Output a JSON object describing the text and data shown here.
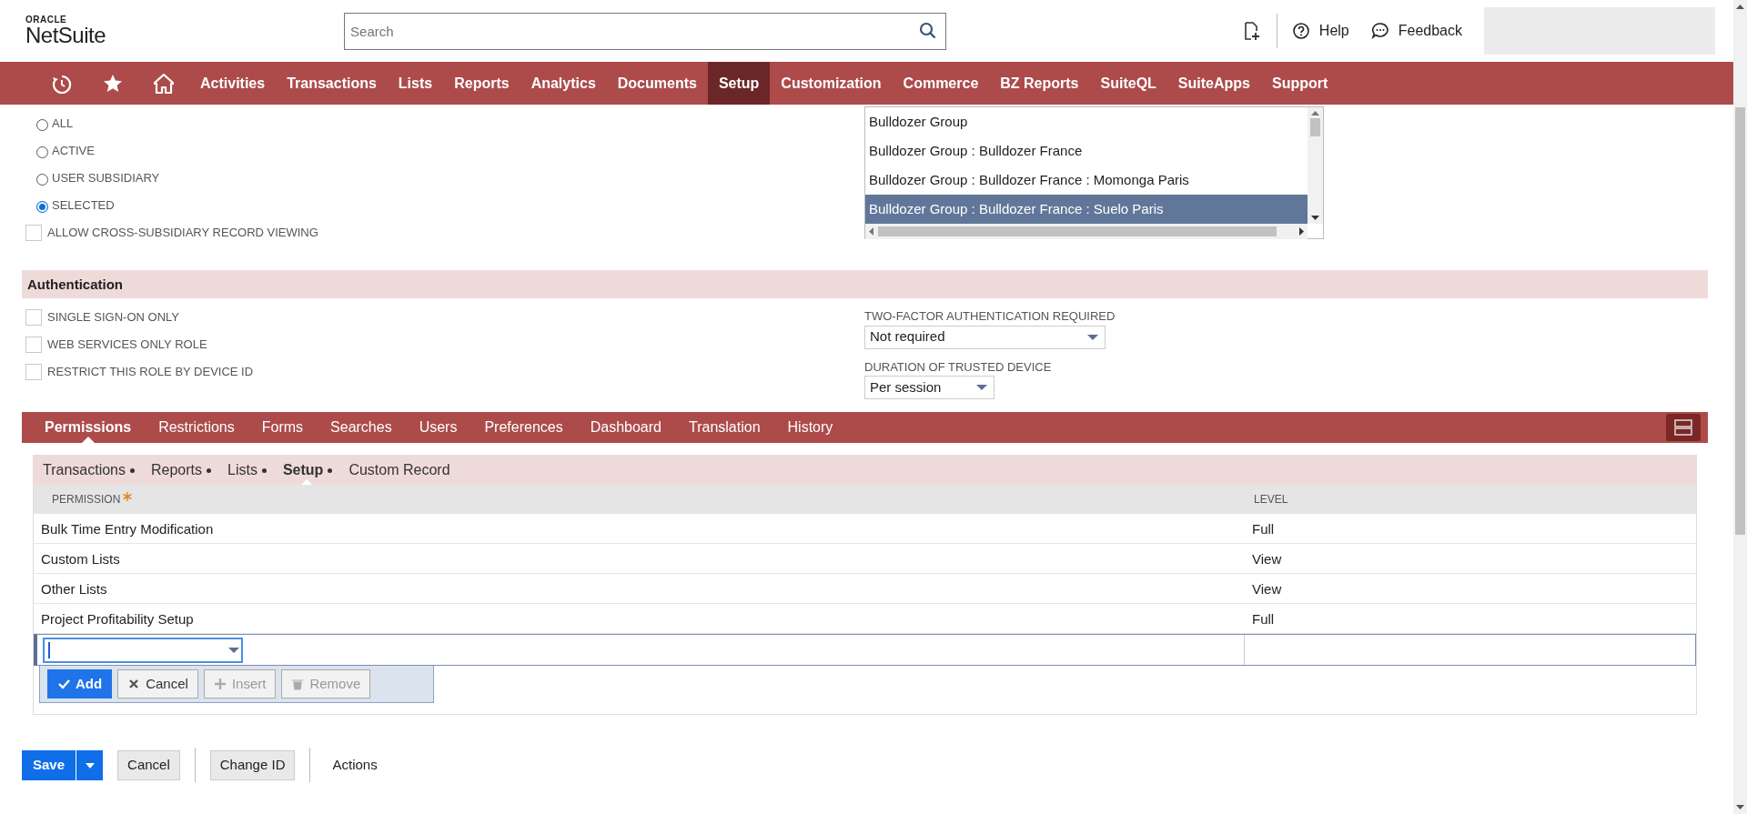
{
  "header": {
    "logo_top": "ORACLE",
    "logo_bottom": "NetSuite",
    "search": {
      "placeholder": "Search"
    },
    "links": [
      {
        "kind": "help",
        "label": "Help"
      },
      {
        "kind": "feedback",
        "label": "Feedback"
      }
    ]
  },
  "nav": {
    "icons": [
      {
        "kind": "recent"
      },
      {
        "kind": "star"
      },
      {
        "kind": "home"
      }
    ],
    "items": [
      {
        "label": "Activities",
        "selected": false
      },
      {
        "label": "Transactions",
        "selected": false
      },
      {
        "label": "Lists",
        "selected": false
      },
      {
        "label": "Reports",
        "selected": false
      },
      {
        "label": "Analytics",
        "selected": false
      },
      {
        "label": "Documents",
        "selected": false
      },
      {
        "label": "Setup",
        "selected": true
      },
      {
        "label": "Customization",
        "selected": false
      },
      {
        "label": "Commerce",
        "selected": false
      },
      {
        "label": "BZ Reports",
        "selected": false
      },
      {
        "label": "SuiteQL",
        "selected": false
      },
      {
        "label": "SuiteApps",
        "selected": false
      },
      {
        "label": "Support",
        "selected": false
      }
    ]
  },
  "subsidiaries": {
    "radios": [
      {
        "label": "ALL",
        "selected": false
      },
      {
        "label": "ACTIVE",
        "selected": false
      },
      {
        "label": "USER SUBSIDIARY",
        "selected": false
      },
      {
        "label": "SELECTED",
        "selected": true
      }
    ],
    "cross_subsidiary": {
      "label": "ALLOW CROSS-SUBSIDIARY RECORD VIEWING",
      "checked": false
    },
    "options": [
      {
        "label": "Bulldozer Group",
        "selected": false
      },
      {
        "label": "Bulldozer Group : Bulldozer France",
        "selected": false
      },
      {
        "label": "Bulldozer Group : Bulldozer France : Momonga Paris",
        "selected": false
      },
      {
        "label": "Bulldozer Group : Bulldozer France : Suelo Paris",
        "selected": true
      }
    ]
  },
  "authentication": {
    "title": "Authentication",
    "checkboxes": [
      {
        "label": "SINGLE SIGN-ON ONLY",
        "checked": false
      },
      {
        "label": "WEB SERVICES ONLY ROLE",
        "checked": false
      },
      {
        "label": "RESTRICT THIS ROLE BY DEVICE ID",
        "checked": false
      }
    ],
    "fields": [
      {
        "label": "TWO-FACTOR AUTHENTICATION REQUIRED",
        "value": "Not required"
      },
      {
        "label": "DURATION OF TRUSTED DEVICE",
        "value": "Per session"
      }
    ]
  },
  "tabs": [
    {
      "label": "Permissions",
      "selected": true
    },
    {
      "label": "Restrictions",
      "selected": false
    },
    {
      "label": "Forms",
      "selected": false
    },
    {
      "label": "Searches",
      "selected": false
    },
    {
      "label": "Users",
      "selected": false
    },
    {
      "label": "Preferences",
      "selected": false
    },
    {
      "label": "Dashboard",
      "selected": false
    },
    {
      "label": "Translation",
      "selected": false
    },
    {
      "label": "History",
      "selected": false
    }
  ],
  "subtabs": [
    {
      "label": "Transactions",
      "selected": false,
      "has_entries": true
    },
    {
      "label": "Reports",
      "selected": false,
      "has_entries": true
    },
    {
      "label": "Lists",
      "selected": false,
      "has_entries": true
    },
    {
      "label": "Setup",
      "selected": true,
      "has_entries": true
    },
    {
      "label": "Custom Record",
      "selected": false,
      "has_entries": false
    }
  ],
  "table": {
    "columns": [
      {
        "label": "PERMISSION",
        "required": true
      },
      {
        "label": "LEVEL",
        "required": false
      }
    ],
    "rows": [
      {
        "permission": "Bulk Time Entry Modification",
        "level": "Full"
      },
      {
        "permission": "Custom Lists",
        "level": "View"
      },
      {
        "permission": "Other Lists",
        "level": "View"
      },
      {
        "permission": "Project Profitability Setup",
        "level": "Full"
      }
    ],
    "edit_buttons": [
      {
        "kind": "add",
        "label": "Add",
        "disabled": false
      },
      {
        "kind": "cancel",
        "label": "Cancel",
        "disabled": false
      },
      {
        "kind": "insert",
        "label": "Insert",
        "disabled": true
      },
      {
        "kind": "remove",
        "label": "Remove",
        "disabled": true
      }
    ]
  },
  "footer": {
    "save": "Save",
    "buttons": [
      {
        "label": "Cancel"
      },
      {
        "label": "Change ID"
      }
    ],
    "actions": "Actions"
  }
}
